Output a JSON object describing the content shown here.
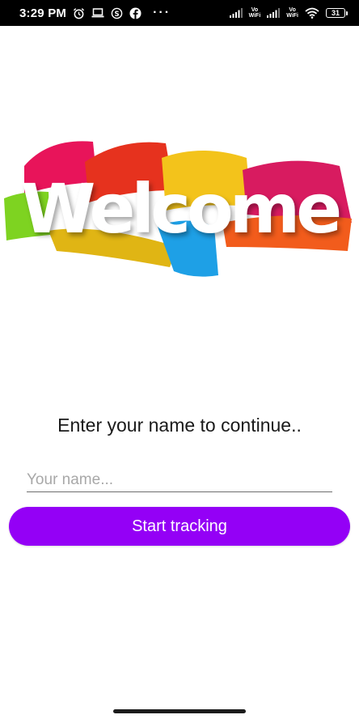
{
  "status_bar": {
    "time": "3:29 PM",
    "left_icons": [
      "alarm-icon",
      "laptop-icon",
      "s-circle-icon",
      "facebook-icon"
    ],
    "more": "···",
    "vowifi_label_top": "Vo",
    "vowifi_label_bottom": "WiFi",
    "battery_level": "31",
    "colors": {
      "background": "#000000",
      "foreground": "#ffffff"
    }
  },
  "banner": {
    "word": "Welcome",
    "brush_colors": [
      "#e8145a",
      "#e6321e",
      "#f3c31b",
      "#7ed321",
      "#1ea0e6",
      "#d81b60",
      "#f25c1c"
    ]
  },
  "prompt": {
    "text": "Enter your name to continue.."
  },
  "name_field": {
    "placeholder": "Your name...",
    "value": ""
  },
  "start_button": {
    "label": "Start tracking",
    "color": "#9400f6"
  }
}
